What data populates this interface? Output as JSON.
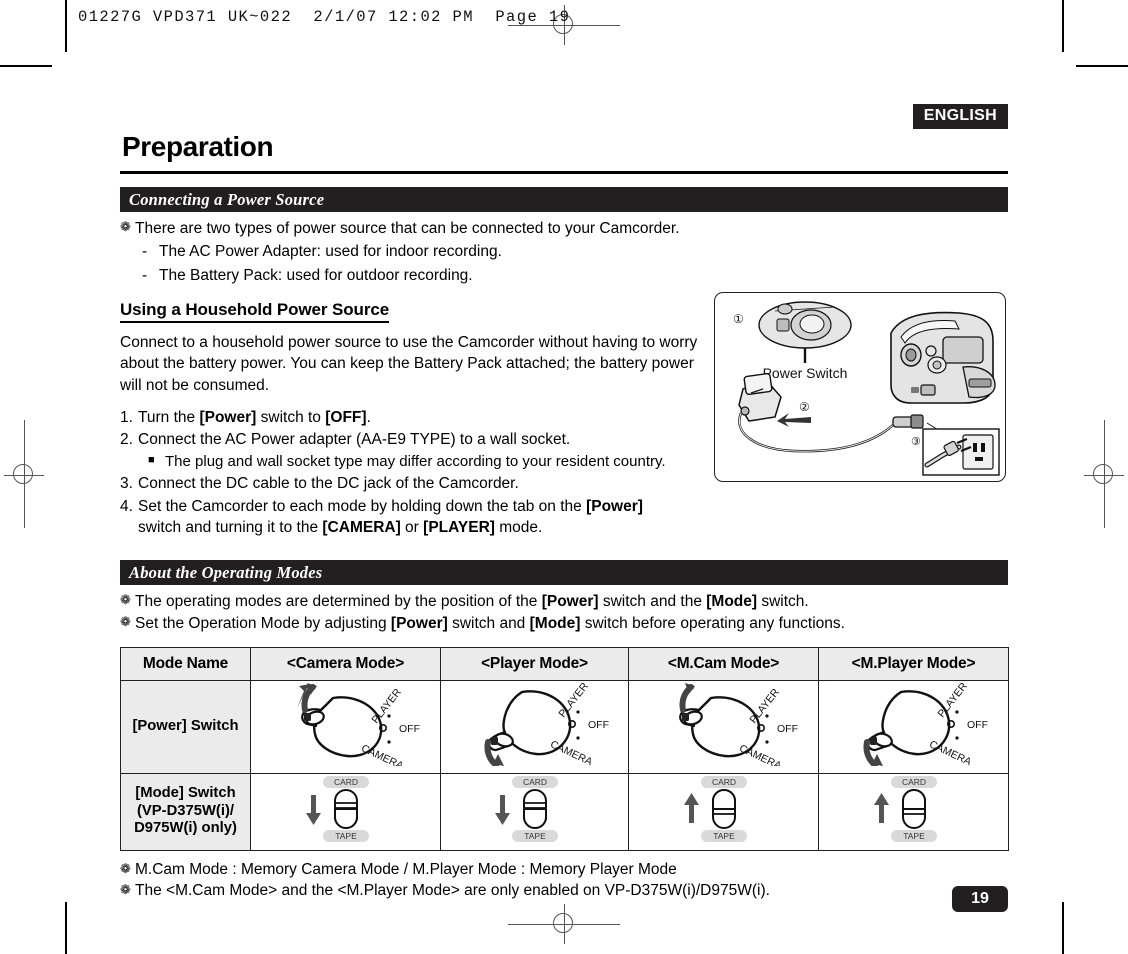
{
  "print_slug": "01227G VPD371 UK~022  2/1/07 12:02 PM  Page 19",
  "language_badge": "ENGLISH",
  "chapter_title": "Preparation",
  "page_number": "19",
  "sections": {
    "power_source": {
      "heading": "Connecting a Power Source",
      "bullets": [
        {
          "glyph": "❁",
          "text": "There are two types of power source that can be connected to your Camcorder."
        }
      ],
      "dashes": [
        {
          "glyph": "-",
          "text": "The AC Power Adapter: used for indoor recording."
        },
        {
          "glyph": "-",
          "text": "The Battery Pack: used for outdoor recording."
        }
      ],
      "sub_heading": "Using a Household Power Source",
      "paragraph": "Connect to a household power source to use the Camcorder without having to worry about the battery power. You can keep the Battery Pack attached; the battery power will not be consumed.",
      "steps": [
        {
          "num": "1.",
          "html": "Turn the <b>[Power]</b> switch to <b>[OFF]</b>."
        },
        {
          "num": "2.",
          "html": "Connect the AC Power adapter (AA-E9 TYPE) to a wall socket."
        },
        {
          "num": "3.",
          "html": "Connect the DC cable to the DC jack of the Camcorder."
        },
        {
          "num": "4.",
          "html": "Set the Camcorder to each mode by holding down the tab on the <b>[Power]</b>"
        }
      ],
      "sub_step": {
        "glyph": "■",
        "text": "The plug and wall socket type may differ according to your resident country."
      },
      "step4_cont": "switch and turning it to the <b>[CAMERA]</b> or <b>[PLAYER]</b> mode."
    },
    "operating_modes": {
      "heading": "About the Operating Modes",
      "bullets": [
        {
          "glyph": "❁",
          "html": "The operating modes are determined by the position of the <b>[Power]</b> switch and the <b>[Mode]</b> switch."
        },
        {
          "glyph": "❁",
          "html": "Set the Operation Mode by adjusting <b>[Power]</b> switch and <b>[Mode]</b> switch before operating any functions."
        }
      ],
      "notes": [
        {
          "glyph": "❁",
          "text": "M.Cam Mode : Memory Camera Mode / M.Player Mode : Memory Player Mode"
        },
        {
          "glyph": "❁",
          "text": "The <M.Cam Mode> and the <M.Player Mode> are only enabled on VP-D375W(i)/D975W(i)."
        }
      ]
    }
  },
  "figure": {
    "caption": "Power Switch",
    "callouts": [
      "①",
      "②",
      "③"
    ]
  },
  "modes_table": {
    "headers": [
      "Mode Name",
      "<Camera Mode>",
      "<Player Mode>",
      "<M.Cam Mode>",
      "<M.Player Mode>"
    ],
    "rows": [
      {
        "label": "[Power] Switch",
        "label_lines": [
          "[Power] Switch"
        ],
        "cells": [
          {
            "dial_labels": [
              "PLAYER",
              "OFF",
              "CAMERA"
            ],
            "arrow": "up"
          },
          {
            "dial_labels": [
              "PLAYER",
              "OFF",
              "CAMERA"
            ],
            "arrow": "down"
          },
          {
            "dial_labels": [
              "PLAYER",
              "OFF",
              "CAMERA"
            ],
            "arrow": "up"
          },
          {
            "dial_labels": [
              "PLAYER",
              "OFF",
              "CAMERA"
            ],
            "arrow": "down"
          }
        ]
      },
      {
        "label": "[Mode] Switch (VP-D375W(i)/ D975W(i) only)",
        "label_lines": [
          "[Mode] Switch",
          "(VP-D375W(i)/",
          "D975W(i) only)"
        ],
        "cells": [
          {
            "top_label": "CARD",
            "bottom_label": "TAPE",
            "arrow": "down",
            "knob": "bottom"
          },
          {
            "top_label": "CARD",
            "bottom_label": "TAPE",
            "arrow": "down",
            "knob": "bottom"
          },
          {
            "top_label": "CARD",
            "bottom_label": "TAPE",
            "arrow": "up",
            "knob": "top"
          },
          {
            "top_label": "CARD",
            "bottom_label": "TAPE",
            "arrow": "up",
            "knob": "top"
          }
        ]
      }
    ]
  },
  "colors": {
    "ink": "#231f20",
    "header_fill": "#ebebeb",
    "gray_label": "#d9d9d9"
  }
}
